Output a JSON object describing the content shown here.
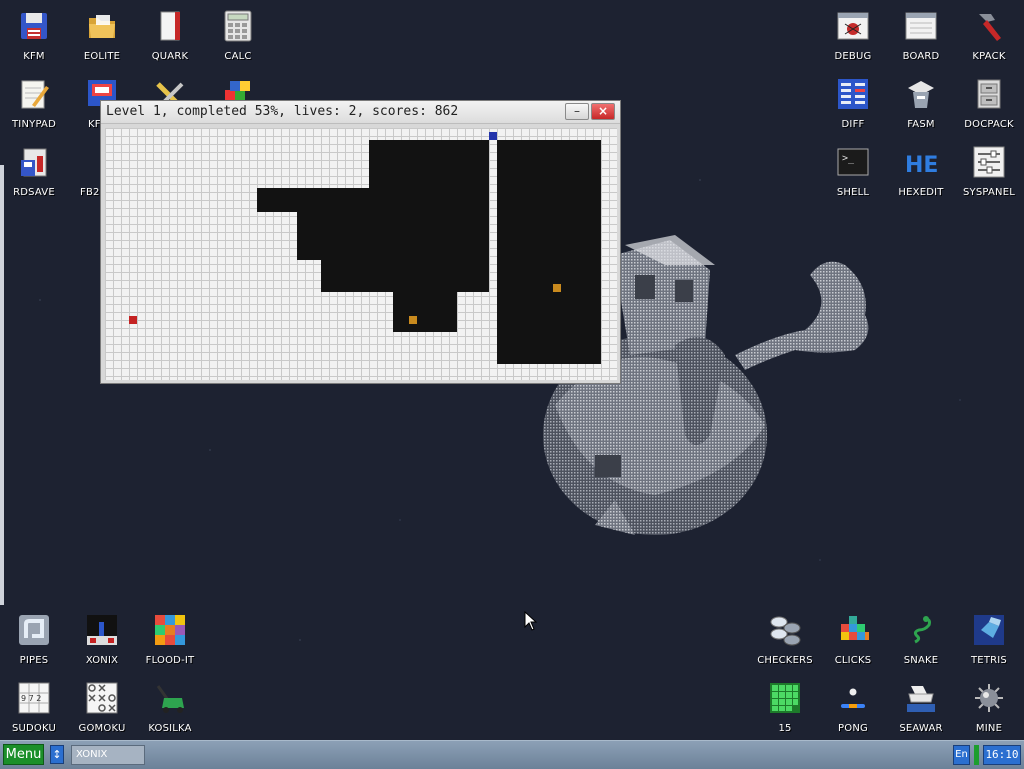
{
  "window": {
    "title": "Level 1, completed 53%, lives: 2, scores: 862",
    "minimize_label": "–",
    "close_label": "×"
  },
  "desktop_icons": {
    "kfm": "KFM",
    "eolite": "EOLITE",
    "quark": "QUARK",
    "calc": "CALC",
    "tinypad": "TINYPAD",
    "kf": "KF",
    "rdsave": "RDSAVE",
    "fb2": "FB2",
    "debug": "DEBUG",
    "board": "BOARD",
    "kpack": "KPACK",
    "diff": "DIFF",
    "fasm": "FASM",
    "docpack": "DOCPACK",
    "shell": "SHELL",
    "hexedit": "HEXEDIT",
    "syspanel": "SYSPANEL",
    "pipes": "PIPES",
    "xonix": "XONIX",
    "flood_it": "FLOOD-IT",
    "sudoku": "SUDOKU",
    "gomoku": "GOMOKU",
    "kosilka": "KOSILKA",
    "checkers": "CHECKERS",
    "clicks": "CLICKS",
    "snake": "SNAKE",
    "tetris": "TETRIS",
    "fifteen": "15",
    "pong": "PONG",
    "seawar": "SEAWAR",
    "mine": "MINE"
  },
  "icon_glyphs": {
    "hexedit_text": "HE",
    "shell_prompt": ">_",
    "sudoku_digits": "9 7 2"
  },
  "taskbar": {
    "menu_label": "Menu",
    "switch_glyph": "↕",
    "task_xonix": "XONIX",
    "lang": "En",
    "clock": "16:10"
  },
  "colors": {
    "menu_green": "#1b8f2a",
    "accent_blue": "#2b6fd0",
    "desktop_bg": "#1d2231",
    "player_blue": "#2233aa",
    "enemy_orange": "#c98a1e",
    "enemy_red": "#c42222"
  }
}
